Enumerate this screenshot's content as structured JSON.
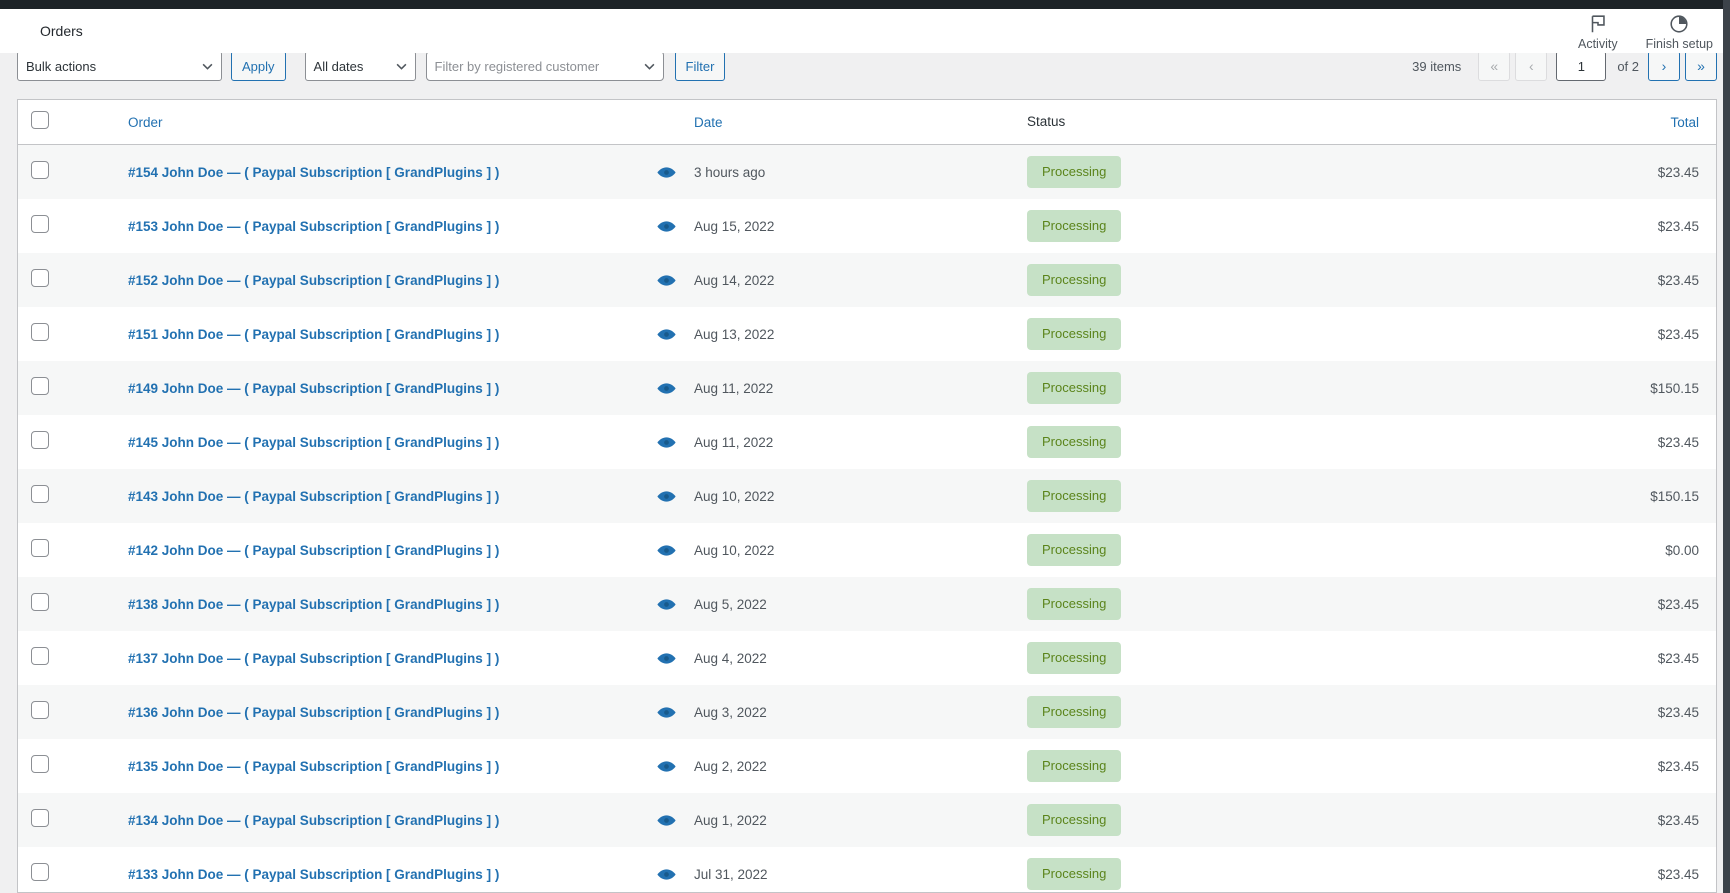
{
  "header": {
    "title": "Orders",
    "activity_label": "Activity",
    "finish_setup_label": "Finish setup"
  },
  "toolbar": {
    "bulk_actions_value": "Bulk actions",
    "apply_label": "Apply",
    "dates_filter_value": "All dates",
    "customer_filter_placeholder": "Filter by registered customer",
    "filter_label": "Filter",
    "pagination": {
      "items_count": "39 items",
      "first_label": "«",
      "prev_label": "‹",
      "current_page": "1",
      "of_label": "of 2",
      "next_label": "›",
      "last_label": "»"
    }
  },
  "table": {
    "columns": {
      "order": "Order",
      "date": "Date",
      "status": "Status",
      "total": "Total"
    },
    "rows": [
      {
        "order": "#154 John Doe — ( Paypal Subscription [ GrandPlugins ] )",
        "date": "3 hours ago",
        "status": "Processing",
        "total": "$23.45"
      },
      {
        "order": "#153 John Doe — ( Paypal Subscription [ GrandPlugins ] )",
        "date": "Aug 15, 2022",
        "status": "Processing",
        "total": "$23.45"
      },
      {
        "order": "#152 John Doe — ( Paypal Subscription [ GrandPlugins ] )",
        "date": "Aug 14, 2022",
        "status": "Processing",
        "total": "$23.45"
      },
      {
        "order": "#151 John Doe — ( Paypal Subscription [ GrandPlugins ] )",
        "date": "Aug 13, 2022",
        "status": "Processing",
        "total": "$23.45"
      },
      {
        "order": "#149 John Doe — ( Paypal Subscription [ GrandPlugins ] )",
        "date": "Aug 11, 2022",
        "status": "Processing",
        "total": "$150.15"
      },
      {
        "order": "#145 John Doe — ( Paypal Subscription [ GrandPlugins ] )",
        "date": "Aug 11, 2022",
        "status": "Processing",
        "total": "$23.45"
      },
      {
        "order": "#143 John Doe — ( Paypal Subscription [ GrandPlugins ] )",
        "date": "Aug 10, 2022",
        "status": "Processing",
        "total": "$150.15"
      },
      {
        "order": "#142 John Doe — ( Paypal Subscription [ GrandPlugins ] )",
        "date": "Aug 10, 2022",
        "status": "Processing",
        "total": "$0.00"
      },
      {
        "order": "#138 John Doe — ( Paypal Subscription [ GrandPlugins ] )",
        "date": "Aug 5, 2022",
        "status": "Processing",
        "total": "$23.45"
      },
      {
        "order": "#137 John Doe — ( Paypal Subscription [ GrandPlugins ] )",
        "date": "Aug 4, 2022",
        "status": "Processing",
        "total": "$23.45"
      },
      {
        "order": "#136 John Doe — ( Paypal Subscription [ GrandPlugins ] )",
        "date": "Aug 3, 2022",
        "status": "Processing",
        "total": "$23.45"
      },
      {
        "order": "#135 John Doe — ( Paypal Subscription [ GrandPlugins ] )",
        "date": "Aug 2, 2022",
        "status": "Processing",
        "total": "$23.45"
      },
      {
        "order": "#134 John Doe — ( Paypal Subscription [ GrandPlugins ] )",
        "date": "Aug 1, 2022",
        "status": "Processing",
        "total": "$23.45"
      },
      {
        "order": "#133 John Doe — ( Paypal Subscription [ GrandPlugins ] )",
        "date": "Jul 31, 2022",
        "status": "Processing",
        "total": "$23.45"
      }
    ]
  },
  "colors": {
    "accent": "#2271b1",
    "status_badge_bg": "#c6e1c6",
    "status_badge_text": "#5b841b",
    "row_stripe": "#f6f7f7",
    "admin_bar": "#1d2327"
  }
}
